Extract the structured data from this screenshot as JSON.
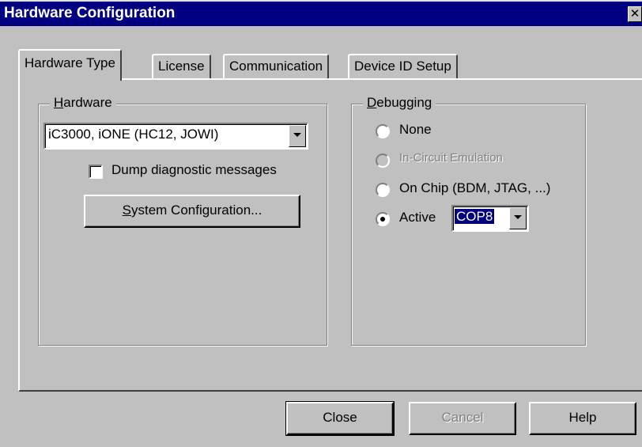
{
  "window": {
    "title": "Hardware Configuration",
    "close_glyph": "✕"
  },
  "tabs": [
    {
      "label": "Hardware Type",
      "active": true
    },
    {
      "label": "License",
      "active": false
    },
    {
      "label": "Communication",
      "active": false
    },
    {
      "label": "Device ID Setup",
      "active": false
    }
  ],
  "hardware": {
    "legend_access": "H",
    "legend_rest": "ardware",
    "selected": "iC3000, iONE (HC12, JOWI)",
    "dump_label": "Dump diagnostic messages",
    "dump_checked": false,
    "sysconfig_access": "S",
    "sysconfig_rest": "ystem Configuration..."
  },
  "debugging": {
    "legend_access": "D",
    "legend_rest": "ebugging",
    "options": [
      {
        "label": "None",
        "selected": false,
        "enabled": true
      },
      {
        "label": "In-Circuit Emulation",
        "selected": false,
        "enabled": false
      },
      {
        "label": "On Chip (BDM, JTAG, ...)",
        "selected": false,
        "enabled": true
      },
      {
        "label": "Active",
        "selected": true,
        "enabled": true
      }
    ],
    "active_device": "COP8"
  },
  "buttons": {
    "close": "Close",
    "cancel": "Cancel",
    "help": "Help"
  },
  "colors": {
    "titlebar": "#000080",
    "face": "#c0c0c0",
    "selection": "#000080"
  }
}
